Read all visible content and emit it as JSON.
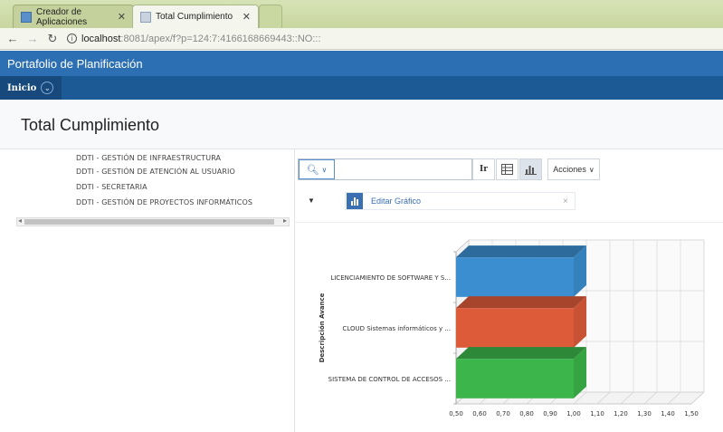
{
  "browser": {
    "tabs": [
      {
        "label": "Creador de Aplicaciones",
        "active": false
      },
      {
        "label": "Total Cumplimiento",
        "active": true
      }
    ],
    "url_host": "localhost",
    "url_path": ":8081/apex/f?p=124:7:4166168669443::NO:::"
  },
  "app": {
    "title": "Portafolio de Planificación",
    "nav_home": "Inicio",
    "page_title": "Total Cumplimiento"
  },
  "tree": {
    "items": [
      "DDTI - GESTIÓN DE INFRAESTRUCTURA",
      "DDTI - GESTIÓN DE ATENCIÓN AL USUARIO",
      "DDTI - SECRETARIA",
      "DDTI - GESTIÓN DE PROYECTOS INFORMÁTICOS"
    ]
  },
  "report": {
    "go_label": "Ir",
    "actions_label": "Acciones",
    "edit_chart_label": "Editar Gráfico",
    "remove_label": "×"
  },
  "chart_data": {
    "type": "bar",
    "orientation": "horizontal",
    "three_d": true,
    "categories": [
      "LICENCIAMIENTO DE SOFTWARE Y S...",
      "CLOUD Sistemas informáticos y ...",
      "SISTEMA DE CONTROL DE ACCESOS ..."
    ],
    "values": [
      1.0,
      1.0,
      1.0
    ],
    "colors": [
      "#3b8fd0",
      "#de5b3a",
      "#3cb54a"
    ],
    "ylabel": "Descripción Avance",
    "xlim": [
      0.5,
      1.5
    ],
    "x_ticks": [
      "0,50",
      "0,60",
      "0,70",
      "0,80",
      "0,90",
      "1,00",
      "1,10",
      "1,20",
      "1,30",
      "1,40",
      "1,50"
    ],
    "grid": true
  }
}
